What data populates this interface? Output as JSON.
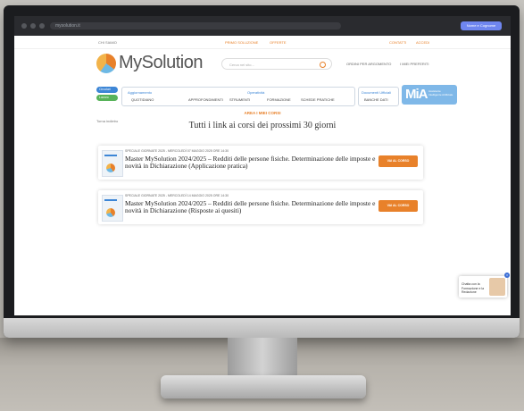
{
  "browser": {
    "url": "mysolution.it",
    "account_button": "Nome e Cognome"
  },
  "topbar": {
    "left": "CHI SIAMO",
    "promo": "PRIMO SOLUZIONE",
    "offers": "OFFERTE",
    "contacts": "CONTATTI",
    "login": "ACCEDI"
  },
  "header": {
    "logo_text": "MySolution",
    "search_placeholder": "Cerca nel sito...",
    "link_rich": "ORDINI PER ARGOMENTO",
    "link_preferiti": "I MIEI PREFERITI"
  },
  "nav": {
    "pill_blue": "Circolari",
    "pill_green": "Lavoro",
    "groups": [
      {
        "top": "Aggiornamento",
        "bottom": "QUOTIDIANO"
      },
      {
        "top": "",
        "bottom": "APPROFONDIMENTI"
      },
      {
        "top": "Operatività",
        "bottom": "STRUMENTI"
      },
      {
        "top": "",
        "bottom": "FORMAZIONE"
      },
      {
        "top": "",
        "bottom": "SCHEDE PRATICHE"
      },
      {
        "top": "Documenti Ufficiali",
        "bottom": "BANCHE DATI"
      }
    ],
    "mia_logo": "MiA",
    "mia_text": "Assistente Intelligente Artificiale"
  },
  "content": {
    "back": "Torna indietro",
    "area_label": "AREA I MIEI CORSI",
    "title": "Tutti i link ai corsi dei prossimi 30 giorni",
    "courses": [
      {
        "meta": "SPECIALE GIORNATE 2025 - MERCOLEDÌ 07 MAGGIO 2025 ORE 14:30",
        "title": "Master MySolution 2024/2025 – Redditi delle persone fisiche. Determinazione delle imposte e novità in Dichiarazione (Applicazione pratica)",
        "cta": "VAI AL CORSO"
      },
      {
        "meta": "SPECIALE GIORNATE 2025 - MERCOLEDÌ 14 MAGGIO 2025 ORE 14:30",
        "title": "Master MySolution 2024/2025 – Redditi delle persone fisiche. Determinazione delle imposte e novità in Dichiarazione (Risposte ai quesiti)",
        "cta": "VAI AL CORSO"
      }
    ]
  },
  "chat": {
    "text": "Chatta con la Formazione e la Redazione"
  }
}
